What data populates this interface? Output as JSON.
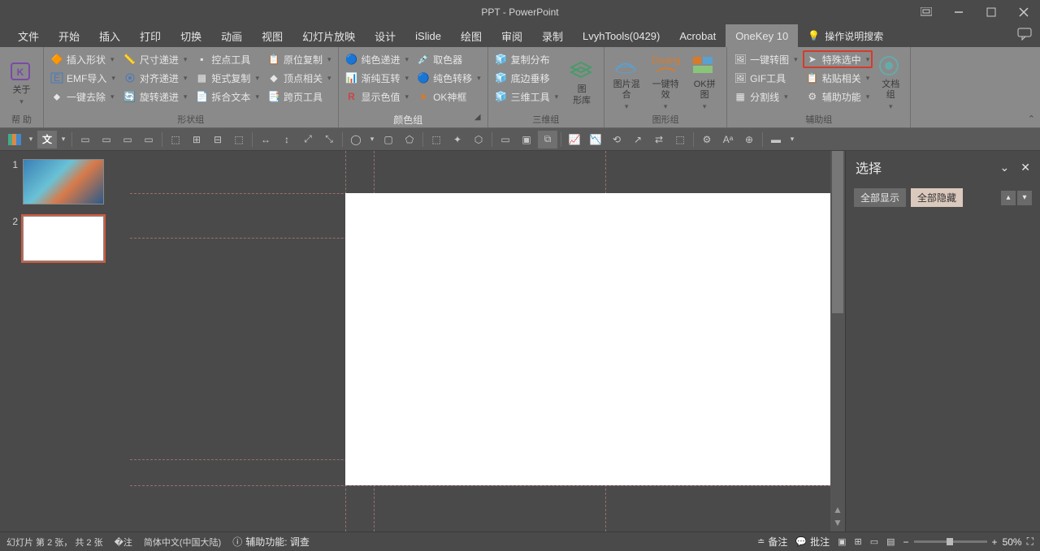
{
  "title": "PPT - PowerPoint",
  "tabs": [
    "文件",
    "开始",
    "插入",
    "打印",
    "切换",
    "动画",
    "视图",
    "幻灯片放映",
    "设计",
    "iSlide",
    "绘图",
    "审阅",
    "录制",
    "LvyhTools(0429)",
    "Acrobat",
    "OneKey 10"
  ],
  "active_tab": "OneKey 10",
  "help_search": "操作说明搜索",
  "ribbon": {
    "help": {
      "about": "关于",
      "label": "帮 助"
    },
    "shape": {
      "c1": [
        "插入形状",
        "EMF导入",
        "一键去除"
      ],
      "c2": [
        "尺寸递进",
        "对齐递进",
        "旋转递进"
      ],
      "c3": [
        "控点工具",
        "矩式复制",
        "拆合文本"
      ],
      "c4": [
        "原位复制",
        "顶点相关",
        "跨页工具"
      ],
      "label": "形状组"
    },
    "color": {
      "c1": [
        "纯色递进",
        "渐纯互转",
        "显示色值"
      ],
      "c2": [
        "取色器",
        "纯色转移",
        "OK神框"
      ],
      "label": "颜色组"
    },
    "three_d": {
      "c1": [
        "复制分布",
        "底边垂移",
        "三维工具"
      ],
      "big": "图\n形库",
      "label": "三维组"
    },
    "graphic": {
      "b1": "图片混\n合",
      "b2": "一键特\n效",
      "b3": "OK拼\n图",
      "label": "图形组"
    },
    "aux": {
      "c1": [
        "一键转图",
        "GIF工具",
        "分割线"
      ],
      "c2": [
        "特殊选中",
        "粘贴相关",
        "辅助功能"
      ],
      "big": "文档\n组",
      "label": "辅助组"
    }
  },
  "selection_pane": {
    "title": "选择",
    "show_all": "全部显示",
    "hide_all": "全部隐藏"
  },
  "status": {
    "slide": "幻灯片 第 2 张， 共 2 张",
    "lang": "简体中文(中国大陆)",
    "access": "辅助功能: 调查",
    "notes": "备注",
    "comments": "批注",
    "zoom": "50%"
  },
  "thumbs": [
    {
      "n": "1"
    },
    {
      "n": "2"
    }
  ]
}
